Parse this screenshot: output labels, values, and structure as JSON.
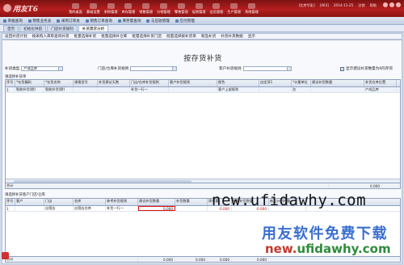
{
  "app": {
    "logo_text": "用友T6",
    "logo_subtitle": "",
    "top_info": [
      "[北京华彩]",
      "[403]",
      "2014-11-25"
    ],
    "top_links": [
      "注销",
      "帮助"
    ]
  },
  "menu": [
    "我的桌面",
    "基础设置",
    "采购管理",
    "库存管理",
    "销售管理",
    "分销管理",
    "零售管理",
    "促销管理",
    "会员管理",
    "生产管理",
    "系统管理"
  ],
  "quickbar": [
    "单据查询",
    "销售业务总",
    "采购订单总",
    "销售订单查询",
    "库存量查询",
    "与应收管理",
    "应付管理"
  ],
  "tabs": [
    "首页",
    "初始化导航",
    "门店补货规则",
    "补货需求分析"
  ],
  "active_tab": 3,
  "controls": [
    "返回补货计划",
    "按采购入库单查询补货",
    "批量选择补货",
    "批量选择补仓库",
    "批量选择补货门店",
    "批量选择按补货单",
    "新品补货",
    "补货补货数据",
    "显示"
  ],
  "title": "按存货补货",
  "filters": {
    "inventory_class_label": "补货类型",
    "inventory_class_value": "产成品库",
    "warehouse_label": "门店/仓库补货规则",
    "warehouse_value": "",
    "customer_label": "客户补货规则",
    "customer_value": "",
    "checkbox_label": "显示建议补货数量为0的存货",
    "checkbox_checked": true
  },
  "upper_section_label": "请选择补货单",
  "upper_table": {
    "headers": [
      "序号",
      "*存货编码",
      "*存货名称",
      "规格型号",
      "补货建议天数",
      "门店/仓库补货规则",
      "客户补货规则",
      "颜色",
      "自定项1",
      "*计量单位",
      "建议补货数量",
      "补货仓库位置"
    ],
    "rows": [
      [
        "1",
        "智能补货(默)",
        "智能补货(默)",
        "",
        "",
        "补货一行一",
        "",
        "客户上架规则",
        "",
        "台",
        "",
        "产成品库"
      ]
    ],
    "sum_label": "合计",
    "sum_value": "0.000"
  },
  "lower_section_label": "请选择补货客户门店/仓库",
  "lower_table": {
    "headers": [
      "序号",
      "客户",
      "门店",
      "仓库",
      "参考补货规则",
      "建议补货数量",
      "补货数量",
      "周存量",
      "采购补货数量",
      "新品计划补量"
    ],
    "rows": [
      [
        "1",
        "",
        "自营店",
        "自营店仓库",
        "补货一行一",
        "0.000",
        "",
        "-0.000",
        "-0.000",
        ""
      ]
    ],
    "sum_label": "合计",
    "sum_values": [
      "0.000",
      "0.000",
      "0.000",
      "0.000"
    ]
  },
  "watermarks": {
    "url_big": "new.ufidawhy.com",
    "slogan": "用友软件免费下载",
    "url_small_prefix": "new.",
    "url_small_rest": "ufidawhy.com"
  }
}
